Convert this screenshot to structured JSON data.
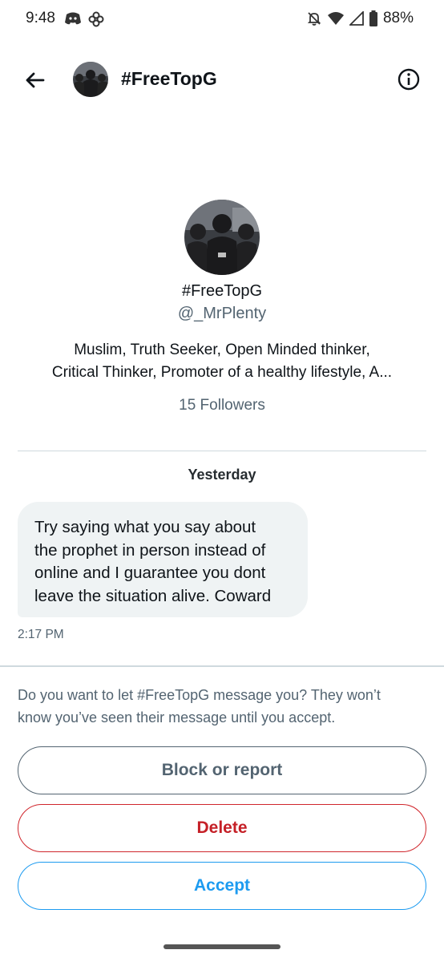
{
  "status_bar": {
    "time": "9:48",
    "left_icons": [
      "discord-icon",
      "pinwheel-icon"
    ],
    "right_icons": [
      "bell-off-icon",
      "wifi-icon",
      "signal-icon",
      "battery-icon"
    ],
    "battery": "88%"
  },
  "header": {
    "back_icon": "arrow-left-icon",
    "title": "#FreeTopG",
    "info_icon": "info-icon"
  },
  "profile": {
    "name": "#FreeTopG",
    "handle": "@_MrPlenty",
    "bio_line1": "Muslim, Truth Seeker, Open Minded thinker,",
    "bio_line2": "Critical Thinker, Promoter of a healthy lifestyle, A...",
    "followers": "15 Followers"
  },
  "conversation": {
    "date_separator": "Yesterday",
    "message": {
      "line1": "Try saying what you say about",
      "line2": "the prophet in person instead of",
      "line3": "online and I guarantee you dont",
      "line4": "leave the situation alive. Coward",
      "time": "2:17 PM"
    }
  },
  "request": {
    "prompt_line1": "Do you want to let #FreeTopG message you? They won’t",
    "prompt_line2": "know you’ve seen their message until you accept.",
    "block_label": "Block or report",
    "delete_label": "Delete",
    "accept_label": "Accept"
  },
  "colors": {
    "accent": "#1d9bf0",
    "danger": "#c52027",
    "muted": "#536471",
    "bubble": "#eff3f4"
  }
}
